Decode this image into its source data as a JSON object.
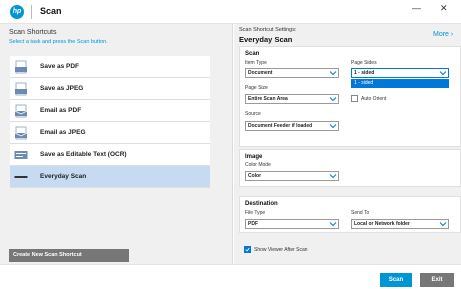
{
  "app": {
    "title": "Scan",
    "logo_text": "hp",
    "window_controls": {
      "minimize": "—",
      "close": "✕"
    }
  },
  "left": {
    "title": "Scan Shortcuts",
    "subtitle": "Select a task and press the Scan button.",
    "shortcuts": [
      {
        "label": "Save as PDF",
        "icon": "pdf-icon"
      },
      {
        "label": "Save as JPEG",
        "icon": "jpeg-icon"
      },
      {
        "label": "Email as PDF",
        "icon": "email-pdf-icon"
      },
      {
        "label": "Email as JPEG",
        "icon": "email-jpeg-icon"
      },
      {
        "label": "Save as Editable Text (OCR)",
        "icon": "ocr-icon"
      },
      {
        "label": "Everyday Scan",
        "icon": "everyday-scan-icon",
        "selected": true
      }
    ],
    "create_button": "Create New Scan Shortcut"
  },
  "right": {
    "settings_label": "Scan Shortcut Settings:",
    "shortcut_name": "Everyday Scan",
    "more_link": "More",
    "scan": {
      "title": "Scan",
      "item_type_label": "Item Type",
      "item_type": "Document",
      "page_sides_label": "Page Sides",
      "page_sides": "1 - sided",
      "page_sides_option": "1 - sided",
      "page_size_label": "Page Size",
      "page_size": "Entire Scan Area",
      "auto_orient_label": "Auto Orient",
      "source_label": "Source",
      "source": "Document Feeder if loaded"
    },
    "image": {
      "title": "Image",
      "color_mode_label": "Color Mode",
      "color_mode": "Color"
    },
    "destination": {
      "title": "Destination",
      "file_type_label": "File Type",
      "file_type": "PDF",
      "send_to_label": "Send To",
      "send_to": "Local or Network folder"
    },
    "show_viewer_label": "Show Viewer After Scan"
  },
  "footer": {
    "scan_button": "Scan",
    "exit_button": "Exit"
  },
  "colors": {
    "accent": "#0096d6",
    "selected_row": "#c6dbf2",
    "dropdown_highlight": "#0078d7",
    "secondary_button": "#777777"
  }
}
